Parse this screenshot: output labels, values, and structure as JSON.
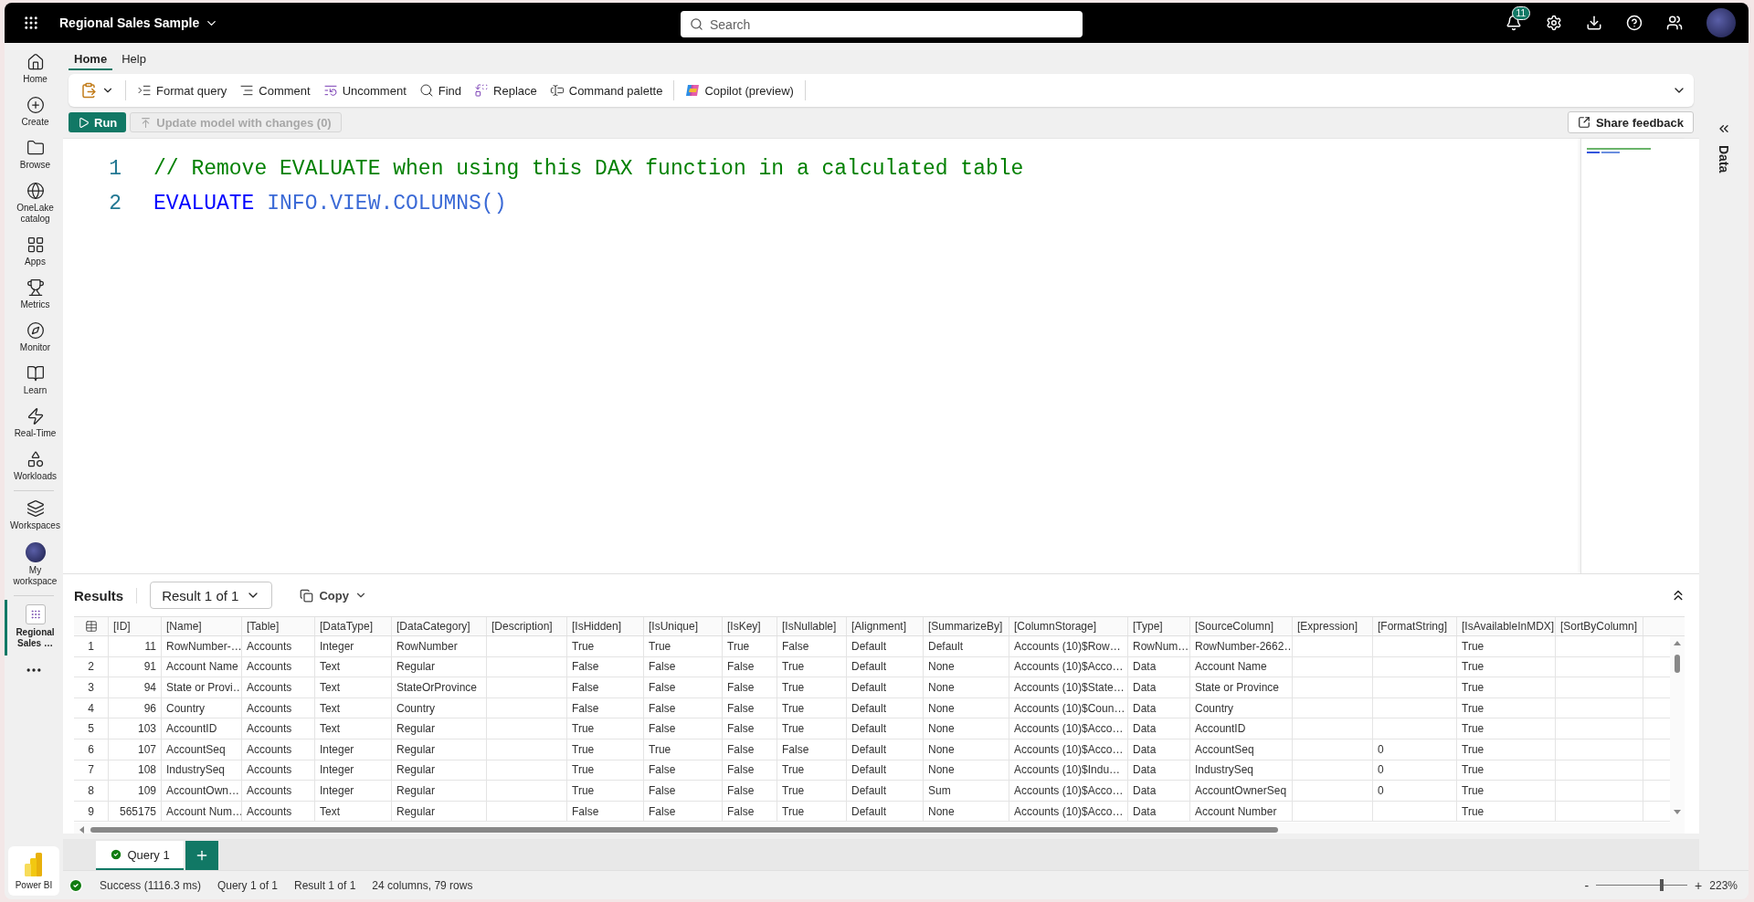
{
  "header": {
    "title": "Regional Sales Sample",
    "search": {
      "placeholder": "Search"
    },
    "notifications": "11"
  },
  "nav": {
    "items": [
      {
        "label": "Home",
        "selected": false
      },
      {
        "label": "Create",
        "selected": false
      },
      {
        "label": "Browse",
        "selected": false
      },
      {
        "label": "OneLake catalog",
        "selected": false
      },
      {
        "label": "Apps",
        "selected": false
      },
      {
        "label": "Metrics",
        "selected": false
      },
      {
        "label": "Monitor",
        "selected": false
      },
      {
        "label": "Learn",
        "selected": false
      },
      {
        "label": "Real-Time",
        "selected": false
      },
      {
        "label": "Workloads",
        "selected": false
      },
      {
        "label": "Workspaces",
        "selected": false
      },
      {
        "label": "My workspace",
        "selected": false
      },
      {
        "label": "Regional Sales …",
        "selected": true
      }
    ],
    "product": "Power BI"
  },
  "ribbon": {
    "tabs": [
      {
        "label": "Home",
        "selected": true
      },
      {
        "label": "Help",
        "selected": false
      }
    ],
    "tools": [
      "Format query",
      "Comment",
      "Uncomment",
      "Find",
      "Replace",
      "Command palette",
      "Copilot (preview)"
    ]
  },
  "actions": {
    "run": "Run",
    "update": {
      "label": "Update model with changes (0)",
      "disabled": true
    },
    "feedback": "Share feedback"
  },
  "editor": {
    "lines": [
      {
        "number": "1",
        "tokens": [
          {
            "kind": "comment",
            "text": "// Remove EVALUATE when using this DAX function in a calculated table"
          }
        ]
      },
      {
        "number": "2",
        "tokens": [
          {
            "kind": "keyword",
            "text": "EVALUATE"
          },
          {
            "kind": "function",
            "text": "INFO.VIEW.COLUMNS()"
          }
        ]
      }
    ]
  },
  "side_panel": {
    "label": "Data"
  },
  "results": {
    "title": "Results",
    "result_picker": "Result 1 of 1",
    "copy": "Copy",
    "columns": [
      {
        "label": "[ID]",
        "kind": "number"
      },
      {
        "label": "[Name]",
        "kind": "text"
      },
      {
        "label": "[Table]",
        "kind": "text"
      },
      {
        "label": "[DataType]",
        "kind": "text"
      },
      {
        "label": "[DataCategory]",
        "kind": "text"
      },
      {
        "label": "[Description]",
        "kind": "text"
      },
      {
        "label": "[IsHidden]",
        "kind": "text"
      },
      {
        "label": "[IsUnique]",
        "kind": "text"
      },
      {
        "label": "[IsKey]",
        "kind": "text"
      },
      {
        "label": "[IsNullable]",
        "kind": "text"
      },
      {
        "label": "[Alignment]",
        "kind": "text"
      },
      {
        "label": "[SummarizeBy]",
        "kind": "text"
      },
      {
        "label": "[ColumnStorage]",
        "kind": "text"
      },
      {
        "label": "[Type]",
        "kind": "text"
      },
      {
        "label": "[SourceColumn]",
        "kind": "text"
      },
      {
        "label": "[Expression]",
        "kind": "text"
      },
      {
        "label": "[FormatString]",
        "kind": "text"
      },
      {
        "label": "[IsAvailableInMDX]",
        "kind": "text"
      },
      {
        "label": "[SortByColumn]",
        "kind": "text"
      }
    ],
    "rows": [
      {
        "number": "1",
        "cells": [
          "11",
          "RowNumber-…",
          "Accounts",
          "Integer",
          "RowNumber",
          null,
          "True",
          "True",
          "True",
          "False",
          "Default",
          "Default",
          "Accounts (10)$Row…",
          "RowNum…",
          "RowNumber-2662…",
          null,
          null,
          "True",
          null
        ]
      },
      {
        "number": "2",
        "cells": [
          "91",
          "Account Name",
          "Accounts",
          "Text",
          "Regular",
          null,
          "False",
          "False",
          "False",
          "True",
          "Default",
          "None",
          "Accounts (10)$Acco…",
          "Data",
          "Account Name",
          null,
          null,
          "True",
          null
        ]
      },
      {
        "number": "3",
        "cells": [
          "94",
          "State or Provi…",
          "Accounts",
          "Text",
          "StateOrProvince",
          null,
          "False",
          "False",
          "False",
          "True",
          "Default",
          "None",
          "Accounts (10)$State…",
          "Data",
          "State or Province",
          null,
          null,
          "True",
          null
        ]
      },
      {
        "number": "4",
        "cells": [
          "96",
          "Country",
          "Accounts",
          "Text",
          "Country",
          null,
          "False",
          "False",
          "False",
          "True",
          "Default",
          "None",
          "Accounts (10)$Coun…",
          "Data",
          "Country",
          null,
          null,
          "True",
          null
        ]
      },
      {
        "number": "5",
        "cells": [
          "103",
          "AccountID",
          "Accounts",
          "Text",
          "Regular",
          null,
          "True",
          "False",
          "False",
          "True",
          "Default",
          "None",
          "Accounts (10)$Acco…",
          "Data",
          "AccountID",
          null,
          null,
          "True",
          null
        ]
      },
      {
        "number": "6",
        "cells": [
          "107",
          "AccountSeq",
          "Accounts",
          "Integer",
          "Regular",
          null,
          "True",
          "True",
          "False",
          "False",
          "Default",
          "None",
          "Accounts (10)$Acco…",
          "Data",
          "AccountSeq",
          null,
          "0",
          "True",
          null
        ]
      },
      {
        "number": "7",
        "cells": [
          "108",
          "IndustrySeq",
          "Accounts",
          "Integer",
          "Regular",
          null,
          "True",
          "False",
          "False",
          "True",
          "Default",
          "None",
          "Accounts (10)$Indu…",
          "Data",
          "IndustrySeq",
          null,
          "0",
          "True",
          null
        ]
      },
      {
        "number": "8",
        "cells": [
          "109",
          "AccountOwn…",
          "Accounts",
          "Integer",
          "Regular",
          null,
          "True",
          "False",
          "False",
          "True",
          "Default",
          "Sum",
          "Accounts (10)$Acco…",
          "Data",
          "AccountOwnerSeq",
          null,
          "0",
          "True",
          null
        ]
      },
      {
        "number": "9",
        "cells": [
          "565175",
          "Account Num…",
          "Accounts",
          "Text",
          "Regular",
          null,
          "False",
          "False",
          "False",
          "True",
          "Default",
          "None",
          "Accounts (10)$Acco…",
          "Data",
          "Account Number",
          null,
          null,
          "True",
          null
        ]
      }
    ]
  },
  "query_tabs": [
    {
      "label": "Query 1",
      "selected": true
    }
  ],
  "status_bar": {
    "items": [
      "Success (1116.3 ms)",
      "Query 1 of 1",
      "Result 1 of 1",
      "24 columns, 79 rows"
    ],
    "zoom": {
      "minus": "-",
      "plus": "+",
      "level": 0.7,
      "reading": "223%"
    }
  }
}
